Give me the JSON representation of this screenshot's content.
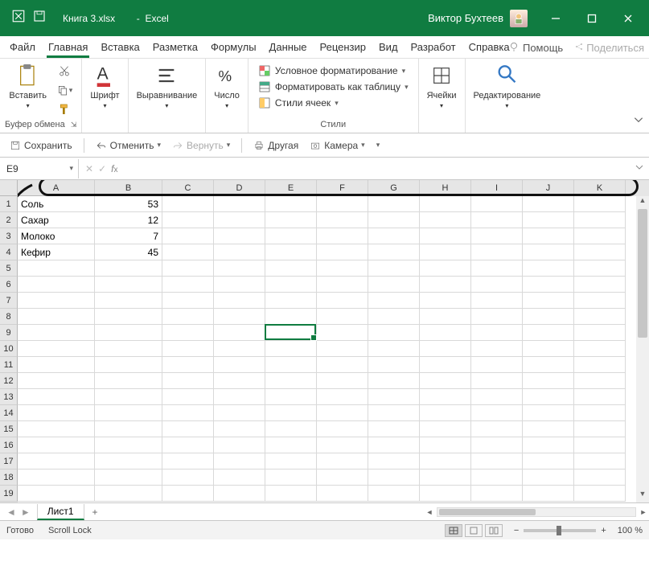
{
  "titlebar": {
    "filename": "Книга 3.xlsx",
    "app": "Excel",
    "user": "Виктор Бухтеев"
  },
  "tabs": {
    "file": "Файл",
    "home": "Главная",
    "insert": "Вставка",
    "layout": "Разметка",
    "formulas": "Формулы",
    "data": "Данные",
    "review": "Рецензир",
    "view": "Вид",
    "developer": "Разработ",
    "help": "Справка",
    "help_btn": "Помощь",
    "share": "Поделиться"
  },
  "ribbon": {
    "paste": "Вставить",
    "clipboard": "Буфер обмена",
    "font": "Шрифт",
    "alignment": "Выравнивание",
    "number": "Число",
    "cond_format": "Условное форматирование",
    "format_table": "Форматировать как таблицу",
    "cell_styles": "Стили ячеек",
    "styles": "Стили",
    "cells": "Ячейки",
    "editing": "Редактирование"
  },
  "quickbar": {
    "save": "Сохранить",
    "undo": "Отменить",
    "redo": "Вернуть",
    "other": "Другая",
    "camera": "Камера"
  },
  "formula": {
    "name_box": "E9"
  },
  "columns": [
    "A",
    "B",
    "C",
    "D",
    "E",
    "F",
    "G",
    "H",
    "I",
    "J",
    "K"
  ],
  "rows_visible": 19,
  "data_rows": [
    {
      "A": "Соль",
      "B": "53"
    },
    {
      "A": "Сахар",
      "B": "12"
    },
    {
      "A": "Молоко",
      "B": "7"
    },
    {
      "A": "Кефир",
      "B": "45"
    }
  ],
  "selected": {
    "col": "E",
    "row": 9
  },
  "sheet": {
    "name": "Лист1"
  },
  "status": {
    "ready": "Готово",
    "scroll_lock": "Scroll Lock",
    "zoom": "100 %"
  }
}
